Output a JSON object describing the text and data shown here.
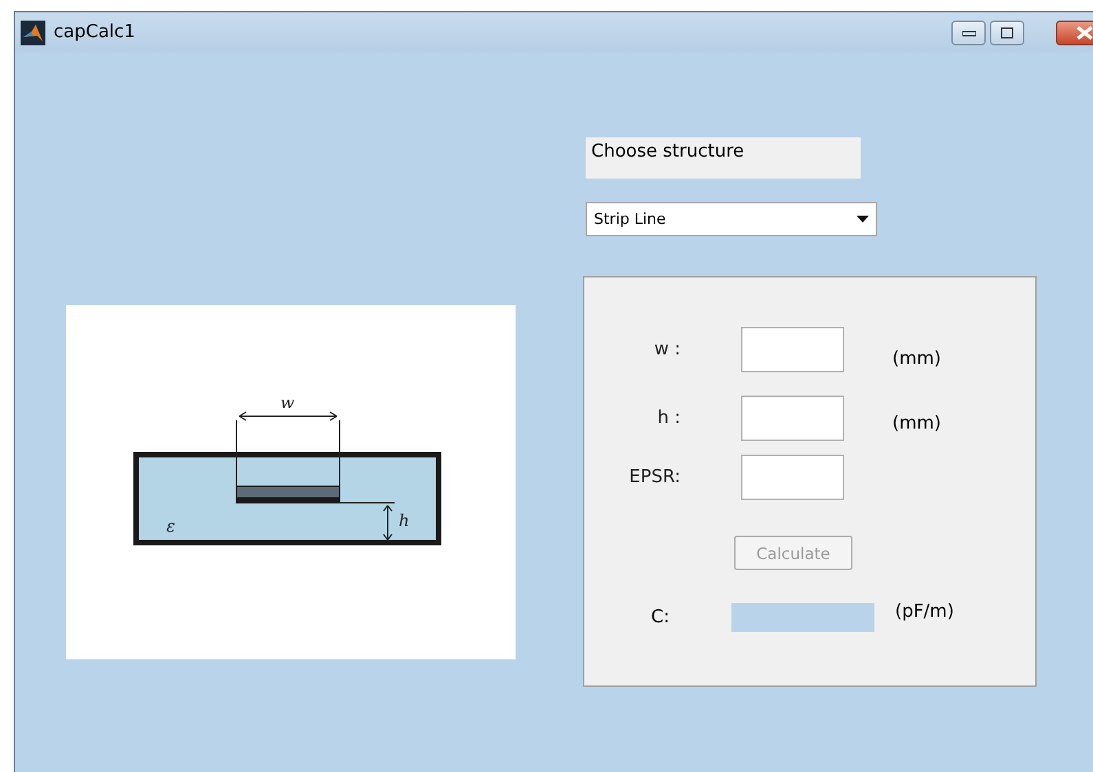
{
  "window": {
    "title": "capCalc1"
  },
  "diagram": {
    "width_label": "w",
    "height_label": "h",
    "permittivity_label": "ε"
  },
  "structure_label": "Choose structure",
  "structure_select": {
    "value": "Strip Line"
  },
  "inputs": [
    {
      "label": "w :",
      "unit": "(mm)"
    },
    {
      "label": "h :",
      "unit": "(mm)"
    },
    {
      "label": "EPSR:"
    }
  ],
  "calculate_button": {
    "label": "Calculate",
    "disabled": true
  },
  "result": {
    "label": "C:",
    "unit": "(pF/m)"
  }
}
